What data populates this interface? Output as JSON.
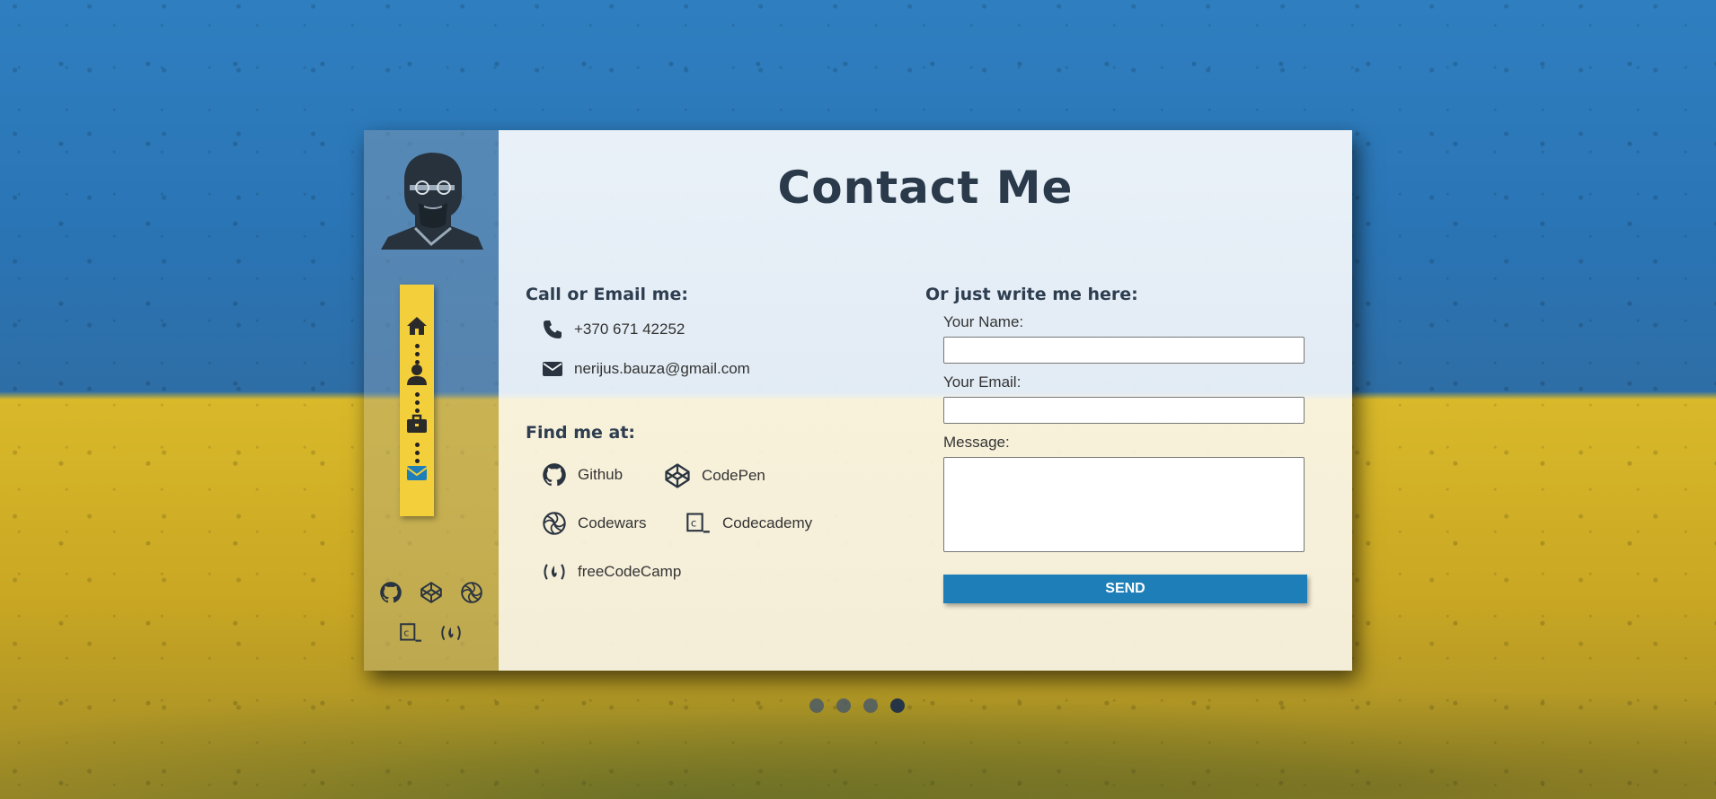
{
  "page": {
    "title": "Contact Me"
  },
  "contact": {
    "heading": "Call or Email me:",
    "phone": "+370 671 42252",
    "email": "nerijus.bauza@gmail.com"
  },
  "find": {
    "heading": "Find me at:",
    "links": [
      {
        "label": "Github",
        "icon": "github-icon"
      },
      {
        "label": "CodePen",
        "icon": "codepen-icon"
      },
      {
        "label": "Codewars",
        "icon": "codewars-icon"
      },
      {
        "label": "Codecademy",
        "icon": "codecademy-icon"
      },
      {
        "label": "freeCodeCamp",
        "icon": "freecodecamp-icon"
      }
    ]
  },
  "form": {
    "heading": "Or just write me here:",
    "name_label": "Your Name:",
    "email_label": "Your Email:",
    "message_label": "Message:",
    "name_value": "",
    "email_value": "",
    "message_value": "",
    "send_label": "SEND"
  },
  "nav": {
    "items": [
      "home-icon",
      "user-icon",
      "briefcase-icon",
      "envelope-icon"
    ],
    "active": "envelope-icon"
  },
  "pager": {
    "count": 4,
    "active_index": 3
  },
  "colors": {
    "nav_bg": "#f4cf3c",
    "accent": "#1e7fb8",
    "heading": "#2e3e50"
  }
}
